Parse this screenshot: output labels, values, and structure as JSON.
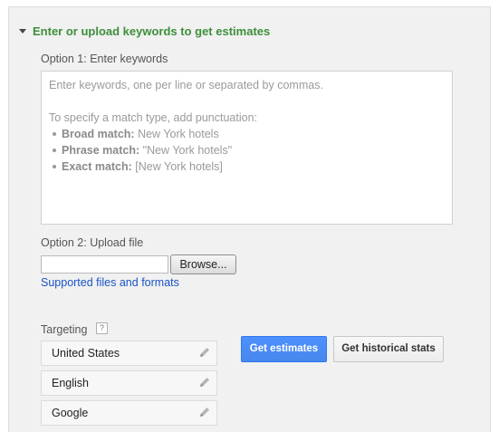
{
  "section": {
    "title": "Enter or upload keywords to get estimates",
    "expanded_icon": "triangle-down-icon"
  },
  "option1": {
    "label": "Option 1: Enter keywords",
    "placeholder_line1": "Enter keywords, one per line or separated by commas.",
    "placeholder_line2": "To specify a match type, add punctuation:",
    "match_types": [
      {
        "name": "Broad match:",
        "example": "New York hotels"
      },
      {
        "name": "Phrase match:",
        "example": "\"New York hotels\""
      },
      {
        "name": "Exact match:",
        "example": "[New York hotels]"
      }
    ]
  },
  "option2": {
    "label": "Option 2: Upload file",
    "file_value": "",
    "browse_label": "Browse...",
    "supported_link": "Supported files and formats"
  },
  "targeting": {
    "label": "Targeting",
    "help_label": "?",
    "items": [
      {
        "label": "United States",
        "icon": "pencil-icon"
      },
      {
        "label": "English",
        "icon": "pencil-icon"
      },
      {
        "label": "Google",
        "icon": "pencil-icon"
      }
    ]
  },
  "actions": {
    "primary_label": "Get estimates",
    "secondary_label": "Get historical stats"
  },
  "colors": {
    "header_green": "#3d8f3a",
    "link_blue": "#1a53c5",
    "primary_blue": "#4d90fe"
  }
}
